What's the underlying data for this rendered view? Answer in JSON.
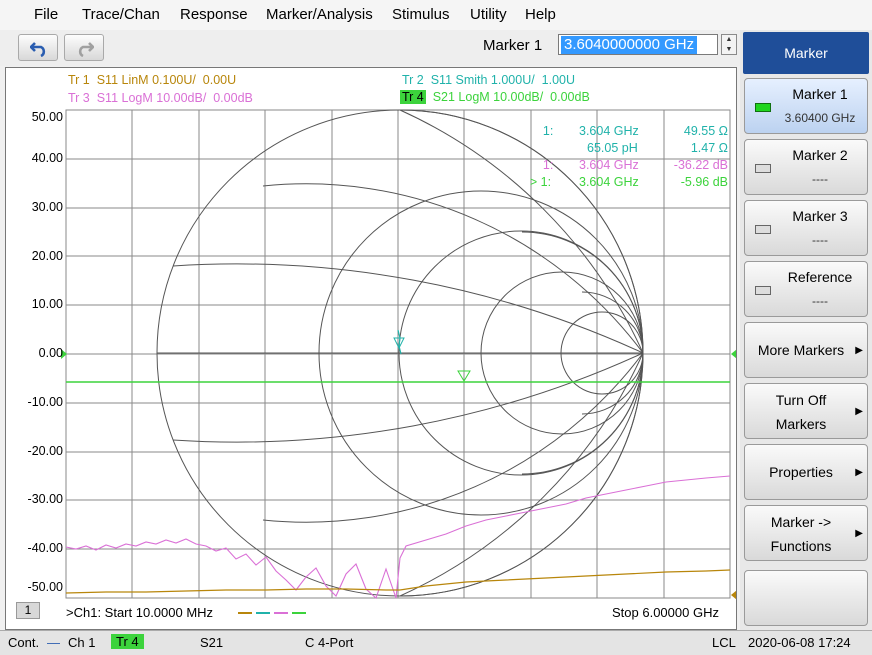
{
  "menu": [
    "File",
    "Trace/Chan",
    "Response",
    "Marker/Analysis",
    "Stimulus",
    "Utility",
    "Help"
  ],
  "toolbar": {
    "undo_icon": "undo-arrow-icon",
    "redo_icon": "redo-arrow-icon",
    "marker_label": "Marker 1",
    "marker_value": "3.6040000000 GHz"
  },
  "traces": {
    "tr1": {
      "name": "Tr 1",
      "text": "S11 LinM 0.100U/  0.00U",
      "color": "#b8860b"
    },
    "tr2": {
      "name": "Tr 2",
      "text": "S11 Smith 1.000U/  1.00U",
      "color": "#20b2aa"
    },
    "tr3": {
      "name": "Tr 3",
      "text": "S11 LogM 10.00dB/  0.00dB",
      "color": "#da70d6"
    },
    "tr4": {
      "name": "Tr 4",
      "text": "S21 LogM 10.00dB/  0.00dB",
      "color": "#3cd33c"
    }
  },
  "y_axis": [
    "50.00",
    "40.00",
    "30.00",
    "20.00",
    "10.00",
    "0.00",
    "-10.00",
    "-20.00",
    "-30.00",
    "-40.00",
    "-50.00"
  ],
  "marker_readout": [
    {
      "label": "1:",
      "freq": "3.604 GHz",
      "value": "49.55 Ω",
      "color": "#20b2aa"
    },
    {
      "label": "",
      "freq": "65.05 pH",
      "value": "1.47 Ω",
      "color": "#20b2aa"
    },
    {
      "label": "1:",
      "freq": "3.604 GHz",
      "value": "-36.22 dB",
      "color": "#da70d6"
    },
    {
      "label": "> 1:",
      "freq": "3.604 GHz",
      "value": "-5.96 dB",
      "color": "#3cd33c"
    }
  ],
  "footer": {
    "channel": "1",
    "start": ">Ch1:  Start  10.0000 MHz",
    "stop": "Stop  6.00000 GHz"
  },
  "softkeys": {
    "title": "Marker",
    "marker1": {
      "label": "Marker 1",
      "value": "3.60400 GHz"
    },
    "marker2": {
      "label": "Marker 2",
      "value": "----"
    },
    "marker3": {
      "label": "Marker 3",
      "value": "----"
    },
    "reference": {
      "label": "Reference",
      "value": "----"
    },
    "more_markers": "More Markers",
    "turn_off_1": "Turn Off",
    "turn_off_2": "Markers",
    "properties": "Properties",
    "functions_1": "Marker ->",
    "functions_2": "Functions"
  },
  "status": {
    "mode": "Cont.",
    "channel": "Ch 1",
    "trace": "Tr 4",
    "param": "S21",
    "cal": "C  4-Port",
    "lcl": "LCL",
    "datetime": "2020-06-08 17:24"
  }
}
